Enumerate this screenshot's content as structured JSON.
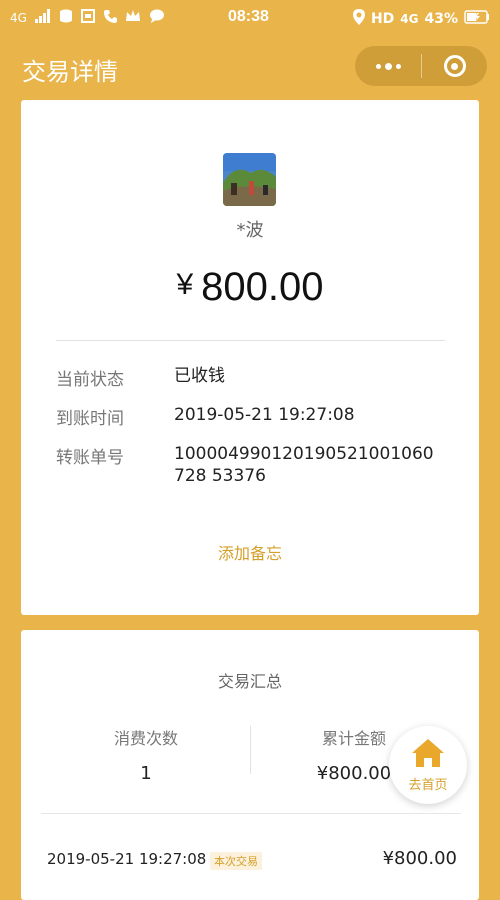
{
  "status_bar": {
    "network_left": "4G",
    "time": "08:38",
    "network_right": "HD",
    "network_right_2": "4G",
    "battery": "43%"
  },
  "nav": {
    "title": "交易详情"
  },
  "transaction": {
    "payer_name": "*波",
    "currency_symbol": "¥",
    "amount": "800.00",
    "details": [
      {
        "label": "当前状态",
        "value": "已收钱"
      },
      {
        "label": "到账时间",
        "value": "2019-05-21 19:27:08"
      },
      {
        "label": "转账单号",
        "value": "100004990120190521001060728 53376"
      }
    ],
    "add_note": "添加备忘"
  },
  "summary": {
    "title": "交易汇总",
    "count_label": "消费次数",
    "count_value": "1",
    "total_label": "累计金额",
    "total_value": "¥800.00"
  },
  "records": [
    {
      "date": "2019-05-21 19:27:08",
      "tag": "本次交易",
      "amount": "¥800.00"
    }
  ],
  "home_button": {
    "label": "去首页"
  },
  "colors": {
    "brand": "#E9B449",
    "accent_text": "#D4A02A"
  }
}
